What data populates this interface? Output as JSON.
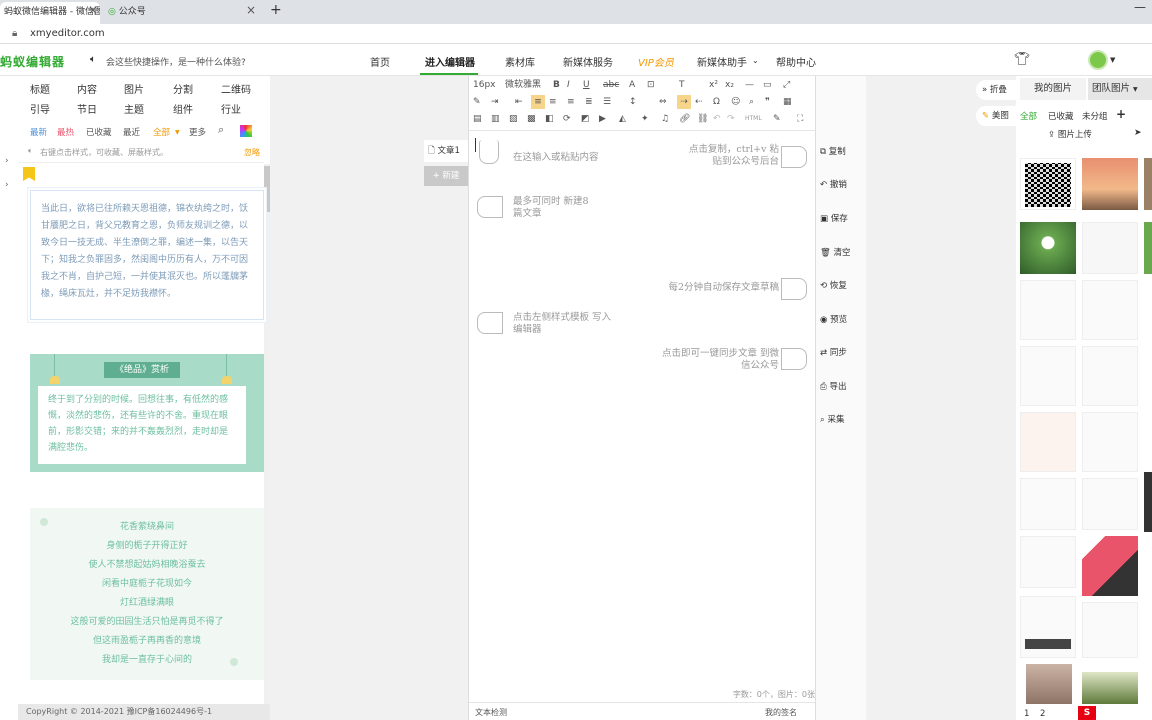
{
  "browser": {
    "tabs": [
      {
        "label": "蚂蚁微信编辑器 - 微信图文",
        "active": true
      },
      {
        "label": "公众号",
        "active": false
      }
    ],
    "new_tab": "+",
    "url": "xmyeditor.com"
  },
  "site": {
    "logo": "蚂蚁编辑器",
    "notice": "会这些快捷操作，是一种什么体验?",
    "nav": [
      "首页",
      "进入编辑器",
      "素材库",
      "新媒体服务",
      "VIP会员",
      "新媒体助手",
      "帮助中心"
    ],
    "nav_active": "进入编辑器"
  },
  "left": {
    "categories_row1": [
      "标题",
      "内容",
      "图片",
      "分割",
      "二维码"
    ],
    "categories_row2": [
      "引导",
      "节日",
      "主题",
      "组件",
      "行业"
    ],
    "filters": [
      "最新",
      "最热",
      "已收藏",
      "最近",
      "全部",
      "更多"
    ],
    "tip": "右键点击样式，可收藏、屏蔽样式。",
    "tip_action": "忽略",
    "card1_text": "当此日，欲将已往所赖天恩祖德，锦衣纨绔之时，饫甘餍肥之日，背父兄教育之恩，负师友规训之德，以致今日一技无成、半生潦倒之罪，编述一集，以告天下；知我之负罪固多，然闺阁中历历有人，万不可因我之不肖，自护己短，一并使其泯灭也。所以蓬牖茅椽，绳床瓦灶，并不足妨我襟怀。",
    "card2_title": "《绝品》赏析",
    "card2_text": "终于到了分别的时候。回想往事，有低然的感慨，淡然的悲伤，还有些许的不舍。重现在眼前，形影交错；来的并不轰轰烈烈，走时却是满腔悲伤。",
    "card3_lines": [
      "花香萦绕鼻间",
      "身侧的栀子开得正好",
      "使人不禁想起姑妈相晚浴蚕去",
      "闲看中庭栀子花现如今",
      "灯红酒绿满眼",
      "这般可爱的田园生活只怕是再觅不得了",
      "但这雨盈栀子再再香的意境",
      "我却是一直存于心间的"
    ],
    "footer": "CopyRight © 2014-2021 豫ICP备16024496号-1"
  },
  "center": {
    "article_tab": "文章1",
    "new_btn": "+ 新建"
  },
  "editor": {
    "font_size": "16px",
    "font_name": "微软雅黑",
    "placeholder": "在这输入或粘贴内容",
    "hint_copy": "点击复制，ctrl+v 粘贴到公众号后台",
    "hint_new": "最多可同时 新建8篇文章",
    "hint_autosave": "每2分钟自动保存文章草稿",
    "hint_template": "点击左侧样式模板 写入编辑器",
    "hint_sync": "点击即可一键同步文章 到微信公众号",
    "word_count": "字数：0个，图片：0张",
    "footer_left": "文本检测",
    "footer_right": "我的签名"
  },
  "actions": [
    "复制",
    "撤销",
    "保存",
    "清空",
    "恢复",
    "预览",
    "同步",
    "导出",
    "采集"
  ],
  "right": {
    "collapse": "折叠",
    "beautify": "美图",
    "tabs": [
      "我的图片",
      "团队图片"
    ],
    "filters": [
      "全部",
      "已收藏",
      "未分组"
    ],
    "upload": "图片上传",
    "pages": [
      "1",
      "2"
    ]
  },
  "colors": {
    "brand_green": "#33aa33",
    "card_teal": "#9fd6c3",
    "vip_orange": "#f39800"
  }
}
